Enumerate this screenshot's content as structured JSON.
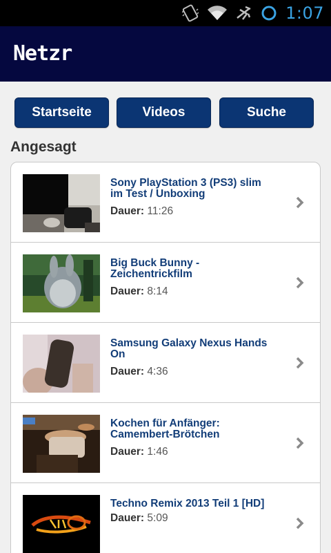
{
  "status": {
    "time": "1:07"
  },
  "app": {
    "title": "Netzr"
  },
  "nav": {
    "home": "Startseite",
    "videos": "Videos",
    "search": "Suche"
  },
  "section": {
    "title": "Angesagt"
  },
  "duration_label": "Dauer:",
  "videos": [
    {
      "title": "Sony PlayStation 3 (PS3) slim im Test / Unboxing",
      "duration": "11:26"
    },
    {
      "title": "Big Buck Bunny - Zeichentrickfilm",
      "duration": "8:14"
    },
    {
      "title": "Samsung Galaxy Nexus Hands On",
      "duration": "4:36"
    },
    {
      "title": "Kochen für Anfänger: Camembert-Brötchen",
      "duration": "1:46"
    },
    {
      "title": "Techno Remix 2013 Teil 1 [HD]",
      "duration": "5:09"
    }
  ]
}
